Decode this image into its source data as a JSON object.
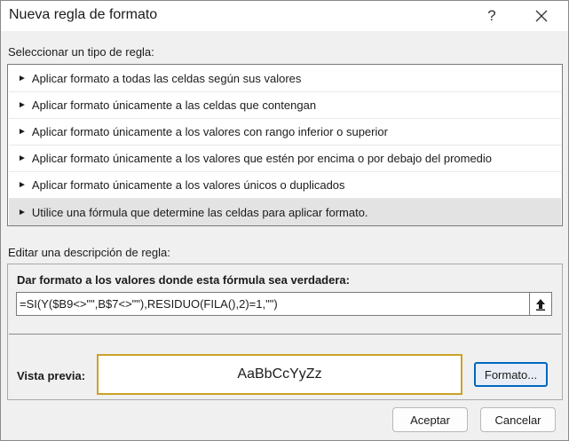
{
  "window": {
    "title": "Nueva regla de formato",
    "help_icon": "?",
    "close_icon": "close-icon"
  },
  "rule_type": {
    "label": "Seleccionar un tipo de regla:",
    "items": [
      {
        "label": "Aplicar formato a todas las celdas según sus valores",
        "selected": false
      },
      {
        "label": "Aplicar formato únicamente a las celdas que contengan",
        "selected": false
      },
      {
        "label": "Aplicar formato únicamente a los valores con rango inferior o superior",
        "selected": false
      },
      {
        "label": "Aplicar formato únicamente a los valores que estén por encima o por debajo del promedio",
        "selected": false
      },
      {
        "label": "Aplicar formato únicamente a los valores únicos o duplicados",
        "selected": false
      },
      {
        "label": "Utilice una fórmula que determine las celdas para aplicar formato.",
        "selected": true
      }
    ]
  },
  "description": {
    "label": "Editar una descripción de regla:",
    "formula_heading": "Dar formato a los valores donde esta fórmula sea verdadera:",
    "formula_value": "=SI(Y($B9<>\"\",B$7<>\"\"),RESIDUO(FILA(),2)=1,\"\")",
    "preview_label": "Vista previa:",
    "preview_text": "AaBbCcYyZz",
    "format_button": "Formato..."
  },
  "footer": {
    "ok_button": "Aceptar",
    "cancel_button": "Cancelar"
  },
  "colors": {
    "accent": "#0067c0",
    "preview_border": "#c9a227",
    "selected_row": "#e3e3e3"
  }
}
